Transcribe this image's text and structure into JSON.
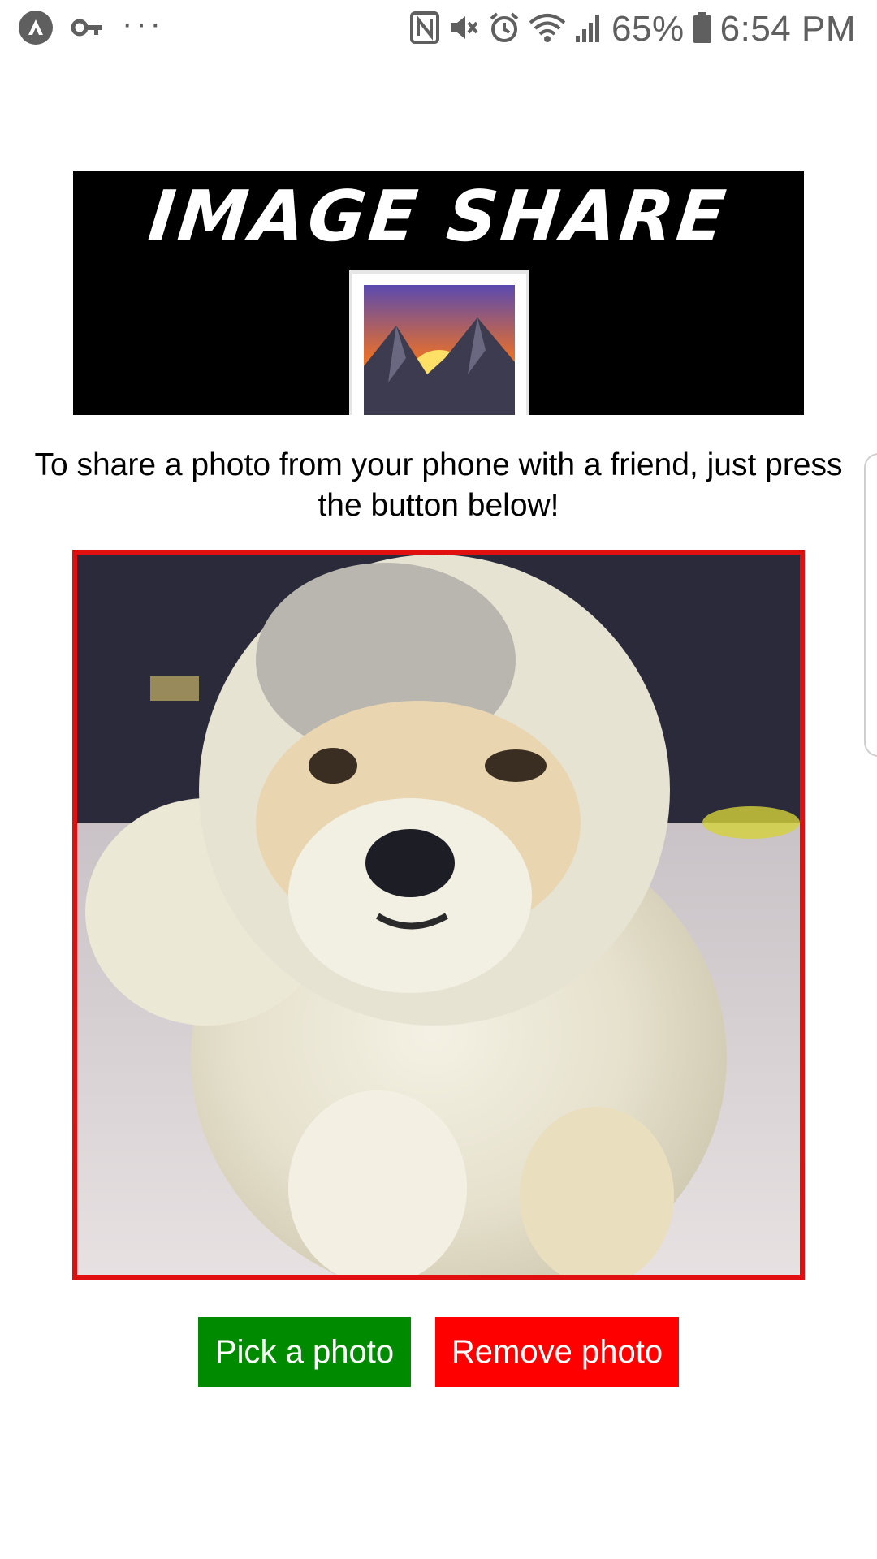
{
  "status_bar": {
    "battery_text": "65%",
    "time": "6:54 PM",
    "icons": [
      "app-badge-icon",
      "key-icon",
      "more-dots-icon",
      "nfc-icon",
      "mute-icon",
      "alarm-icon",
      "wifi-icon",
      "signal-icon",
      "battery-icon"
    ]
  },
  "banner": {
    "title": "IMAGE SHARE"
  },
  "instructions": "To share a photo from your phone with a friend, just press the button below!",
  "photo": {
    "frame_color": "#e01010"
  },
  "buttons": {
    "pick_label": "Pick a photo",
    "pick_color": "#008a00",
    "remove_label": "Remove photo",
    "remove_color": "#ff0000"
  }
}
